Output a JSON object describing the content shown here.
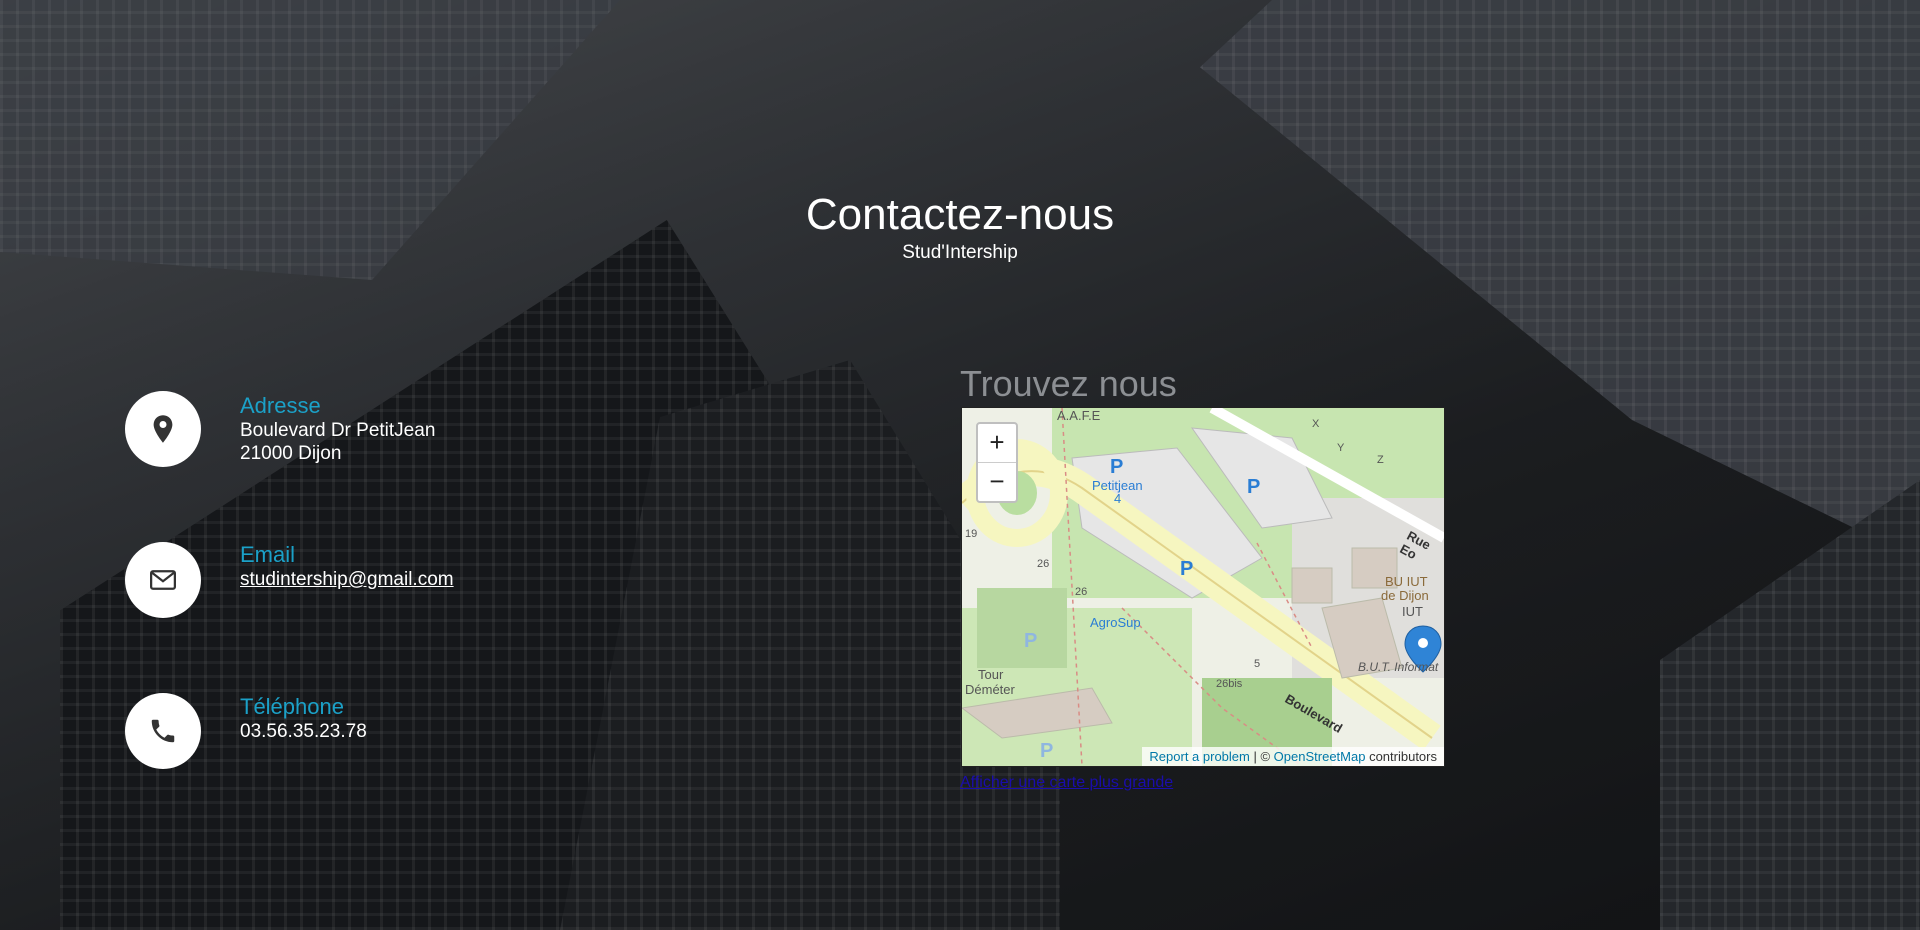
{
  "header": {
    "title": "Contactez-nous",
    "subtitle": "Stud'Intership"
  },
  "contact": {
    "address": {
      "label": "Adresse",
      "line1": "Boulevard Dr PetitJean",
      "line2": "21000 Dijon",
      "icon": "map-marker-icon"
    },
    "email": {
      "label": "Email",
      "value": "studintership@gmail.com",
      "icon": "envelope-icon"
    },
    "phone": {
      "label": "Téléphone",
      "value": "03.56.35.23.78",
      "icon": "phone-icon"
    }
  },
  "map": {
    "title": "Trouvez nous",
    "zoom_in": "+",
    "zoom_out": "−",
    "attribution": {
      "report": "Report a problem",
      "sep": " | © ",
      "osm": "OpenStreetMap",
      "contrib": " contributors"
    },
    "larger_link": "Afficher une carte plus grande",
    "labels": {
      "aafe": "A.A.F.E",
      "petitjean": "Petitjean",
      "four": "4",
      "agrosup": "AgroSup",
      "tour": "Tour",
      "demeter": "Déméter",
      "bu": "BU IUT",
      "dedijon": "de Dijon",
      "iut": "IUT",
      "but": "B.U.T. Informat",
      "rue": "Rue Eo",
      "boulevard": "Boulevard",
      "n19": "19",
      "n26a": "26",
      "n26b": "26",
      "n5": "5",
      "n26bis": "26bis",
      "x": "X",
      "y": "Y",
      "z": "Z",
      "p": "P"
    }
  },
  "colors": {
    "accent": "#1ba1c8",
    "link": "#1a0dab"
  }
}
